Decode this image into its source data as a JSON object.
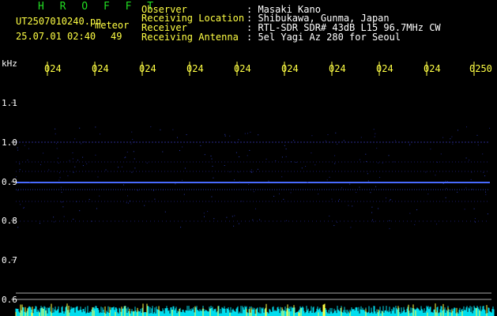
{
  "header": {
    "title": "H R O F F T",
    "filename": "UT2507010240.pn",
    "detector": "meteor",
    "datetime": "25.07.01 02:40",
    "count": "49"
  },
  "info": {
    "observer_label": "Observer",
    "observer_value": ": Masaki Kano",
    "location_label": "Receiving Location",
    "location_value": ": Shibukawa, Gunma, Japan",
    "receiver_label": "Receiver",
    "receiver_value": ": RTL-SDR SDR# 43dB L15 96.7MHz CW",
    "antenna_label": "Receiving Antenna",
    "antenna_value": ": 5el Yagi Az 280 for Seoul"
  },
  "axis": {
    "unit": "kHz",
    "y_ticks": [
      "1.1",
      "1.0",
      "0.9",
      "0.8",
      "0.7",
      "0.6"
    ],
    "x_ticks": [
      "024",
      "024",
      "024",
      "024",
      "024",
      "024",
      "024",
      "024",
      "024",
      "0250"
    ]
  },
  "colors": {
    "background": "#000000",
    "grid_line": "#2a2a8a",
    "carrier": "#3355ff",
    "noise_bar": "#00ddee",
    "tick_label": "#ffff44",
    "title": "#22dd22"
  }
}
